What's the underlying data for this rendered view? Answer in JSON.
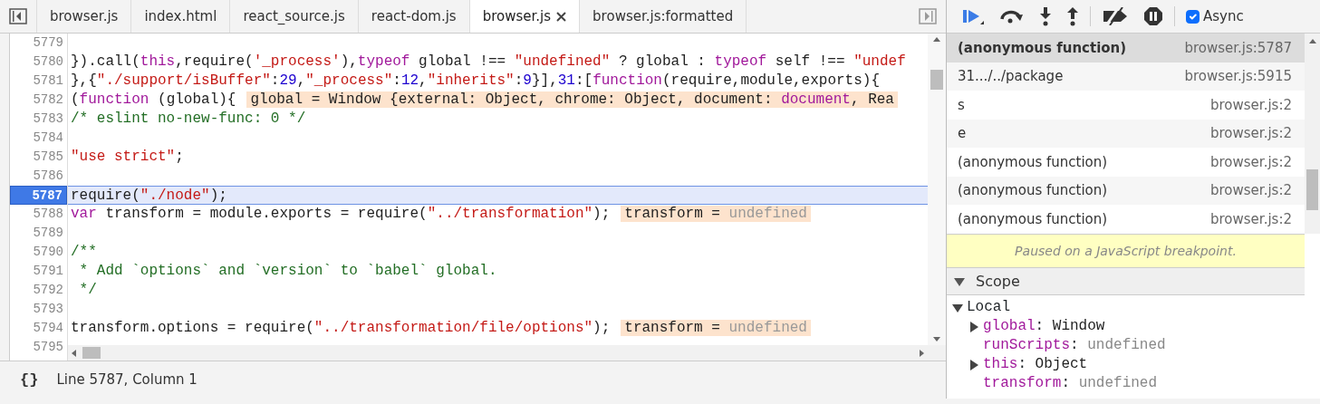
{
  "editor_tabs": [
    {
      "label": "browser.js",
      "selected": false,
      "closable": false
    },
    {
      "label": "index.html",
      "selected": false,
      "closable": false
    },
    {
      "label": "react_source.js",
      "selected": false,
      "closable": false
    },
    {
      "label": "react-dom.js",
      "selected": false,
      "closable": false
    },
    {
      "label": "browser.js",
      "selected": true,
      "closable": true
    },
    {
      "label": "browser.js:formatted",
      "selected": false,
      "closable": false
    }
  ],
  "code_lines": [
    {
      "number": "5779",
      "current": false
    },
    {
      "number": "5780",
      "current": false,
      "tokens": [
        {
          "t": "}).call(",
          "kind": "plain"
        },
        {
          "t": "this",
          "kind": "keyword"
        },
        {
          "t": ",require(",
          "kind": "plain"
        },
        {
          "t": "'_process'",
          "kind": "string"
        },
        {
          "t": "),",
          "kind": "plain"
        },
        {
          "t": "typeof",
          "kind": "keyword"
        },
        {
          "t": " global !== ",
          "kind": "plain"
        },
        {
          "t": "\"undefined\"",
          "kind": "string"
        },
        {
          "t": " ? global : ",
          "kind": "plain"
        },
        {
          "t": "typeof",
          "kind": "keyword"
        },
        {
          "t": " self !== ",
          "kind": "plain"
        },
        {
          "t": "\"undef",
          "kind": "string"
        }
      ]
    },
    {
      "number": "5781",
      "current": false,
      "tokens": [
        {
          "t": "},{",
          "kind": "plain"
        },
        {
          "t": "\"./support/isBuffer\"",
          "kind": "string"
        },
        {
          "t": ":",
          "kind": "plain"
        },
        {
          "t": "29",
          "kind": "number"
        },
        {
          "t": ",",
          "kind": "plain"
        },
        {
          "t": "\"_process\"",
          "kind": "string"
        },
        {
          "t": ":",
          "kind": "plain"
        },
        {
          "t": "12",
          "kind": "number"
        },
        {
          "t": ",",
          "kind": "plain"
        },
        {
          "t": "\"inherits\"",
          "kind": "string"
        },
        {
          "t": ":",
          "kind": "plain"
        },
        {
          "t": "9",
          "kind": "number"
        },
        {
          "t": "}],",
          "kind": "plain"
        },
        {
          "t": "31",
          "kind": "number"
        },
        {
          "t": ":[",
          "kind": "plain"
        },
        {
          "t": "function",
          "kind": "keyword"
        },
        {
          "t": "(require,module,exports){",
          "kind": "plain"
        }
      ]
    },
    {
      "number": "5782",
      "current": false,
      "tokens": [
        {
          "t": "(",
          "kind": "plain"
        },
        {
          "t": "function",
          "kind": "keyword"
        },
        {
          "t": " (global){",
          "kind": "plain"
        }
      ],
      "annotation": [
        {
          "t": "global = Window {external: Object, chrome: Object, document: ",
          "kind": "plain"
        },
        {
          "t": "document",
          "kind": "keyword"
        },
        {
          "t": ", Rea",
          "kind": "plain"
        }
      ]
    },
    {
      "number": "5783",
      "current": false,
      "tokens": [
        {
          "t": "/* eslint no-new-func: 0 */",
          "kind": "comment"
        }
      ]
    },
    {
      "number": "5784",
      "current": false
    },
    {
      "number": "5785",
      "current": false,
      "tokens": [
        {
          "t": "\"use strict\"",
          "kind": "string"
        },
        {
          "t": ";",
          "kind": "plain"
        }
      ]
    },
    {
      "number": "5786",
      "current": false
    },
    {
      "number": "5787",
      "current": true,
      "tokens": [
        {
          "t": "require(",
          "kind": "plain"
        },
        {
          "t": "\"./node\"",
          "kind": "string"
        },
        {
          "t": ");",
          "kind": "plain"
        }
      ]
    },
    {
      "number": "5788",
      "current": false,
      "tokens": [
        {
          "t": "var",
          "kind": "keyword"
        },
        {
          "t": " transform = module.exports = require(",
          "kind": "plain"
        },
        {
          "t": "\"../transformation\"",
          "kind": "string"
        },
        {
          "t": ");",
          "kind": "plain"
        }
      ],
      "annotation": [
        {
          "t": "transform = ",
          "kind": "plain"
        },
        {
          "t": "undefined",
          "kind": "muted"
        }
      ]
    },
    {
      "number": "5789",
      "current": false
    },
    {
      "number": "5790",
      "current": false,
      "tokens": [
        {
          "t": "/**",
          "kind": "comment"
        }
      ]
    },
    {
      "number": "5791",
      "current": false,
      "tokens": [
        {
          "t": " * Add `options` and `version` to `babel` global.",
          "kind": "comment"
        }
      ]
    },
    {
      "number": "5792",
      "current": false,
      "tokens": [
        {
          "t": " */",
          "kind": "comment"
        }
      ]
    },
    {
      "number": "5793",
      "current": false
    },
    {
      "number": "5794",
      "current": false,
      "tokens": [
        {
          "t": "transform.options = require(",
          "kind": "plain"
        },
        {
          "t": "\"../transformation/file/options\"",
          "kind": "string"
        },
        {
          "t": ");",
          "kind": "plain"
        }
      ],
      "annotation": [
        {
          "t": "transform = ",
          "kind": "plain"
        },
        {
          "t": "undefined",
          "kind": "muted"
        }
      ]
    },
    {
      "number": "5795",
      "current": false
    }
  ],
  "status_bar": {
    "format_button": "{}",
    "position": "Line 5787, Column 1"
  },
  "debugger_toolbar": {
    "async": {
      "label": "Async",
      "checked": true
    }
  },
  "call_stack": [
    {
      "name": "(anonymous function)",
      "location": "browser.js:5787",
      "selected": true
    },
    {
      "name": "31.../../package",
      "location": "browser.js:5915",
      "selected": false
    },
    {
      "name": "s",
      "location": "browser.js:2",
      "selected": false
    },
    {
      "name": "e",
      "location": "browser.js:2",
      "selected": false
    },
    {
      "name": "(anonymous function)",
      "location": "browser.js:2",
      "selected": false
    },
    {
      "name": "(anonymous function)",
      "location": "browser.js:2",
      "selected": false
    },
    {
      "name": "(anonymous function)",
      "location": "browser.js:2",
      "selected": false
    }
  ],
  "pause_message": "Paused on a JavaScript breakpoint.",
  "scope": {
    "title": "Scope",
    "expanded": true,
    "children": [
      {
        "label": "Local",
        "expanded": true,
        "children": [
          {
            "name": "global",
            "separator": ":",
            "value": "Window",
            "kind": "object",
            "expanded": false
          },
          {
            "name": "runScripts",
            "separator": ":",
            "value": "undefined",
            "kind": "undefined"
          },
          {
            "name": "this",
            "separator": ":",
            "value": "Object",
            "kind": "object",
            "expanded": false
          },
          {
            "name": "transform",
            "separator": ":",
            "value": "undefined",
            "kind": "undefined"
          }
        ]
      }
    ]
  }
}
